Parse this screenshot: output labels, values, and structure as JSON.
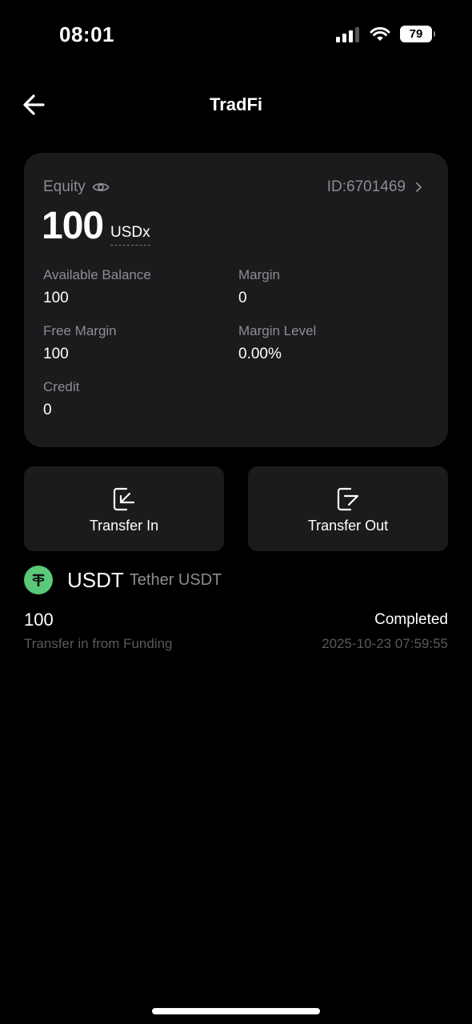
{
  "status_bar": {
    "time": "08:01",
    "battery": "79",
    "icons": [
      "cellular-signal-icon",
      "wifi-icon",
      "battery-icon"
    ]
  },
  "header": {
    "title": "TradFi",
    "back_icon": "arrow-left-icon"
  },
  "account_card": {
    "equity_label": "Equity",
    "equity_value": "100",
    "equity_unit": "USDx",
    "account_id": "ID:6701469",
    "stats": {
      "available_balance": {
        "label": "Available Balance",
        "value": "100"
      },
      "margin": {
        "label": "Margin",
        "value": "0"
      },
      "free_margin": {
        "label": "Free Margin",
        "value": "100"
      },
      "margin_level": {
        "label": "Margin Level",
        "value": "0.00%"
      },
      "credit": {
        "label": "Credit",
        "value": "0"
      }
    }
  },
  "actions": {
    "transfer_in": "Transfer In",
    "transfer_out": "Transfer Out"
  },
  "coin": {
    "symbol": "USDT",
    "name": "Tether USDT",
    "logo_color": "#5ac978"
  },
  "transaction": {
    "amount": "100",
    "description": "Transfer in from Funding",
    "status": "Completed",
    "timestamp": "2025-10-23 07:59:55"
  },
  "colors": {
    "background": "#000000",
    "card": "#1b1b1d",
    "muted_text": "#8d8d92"
  }
}
